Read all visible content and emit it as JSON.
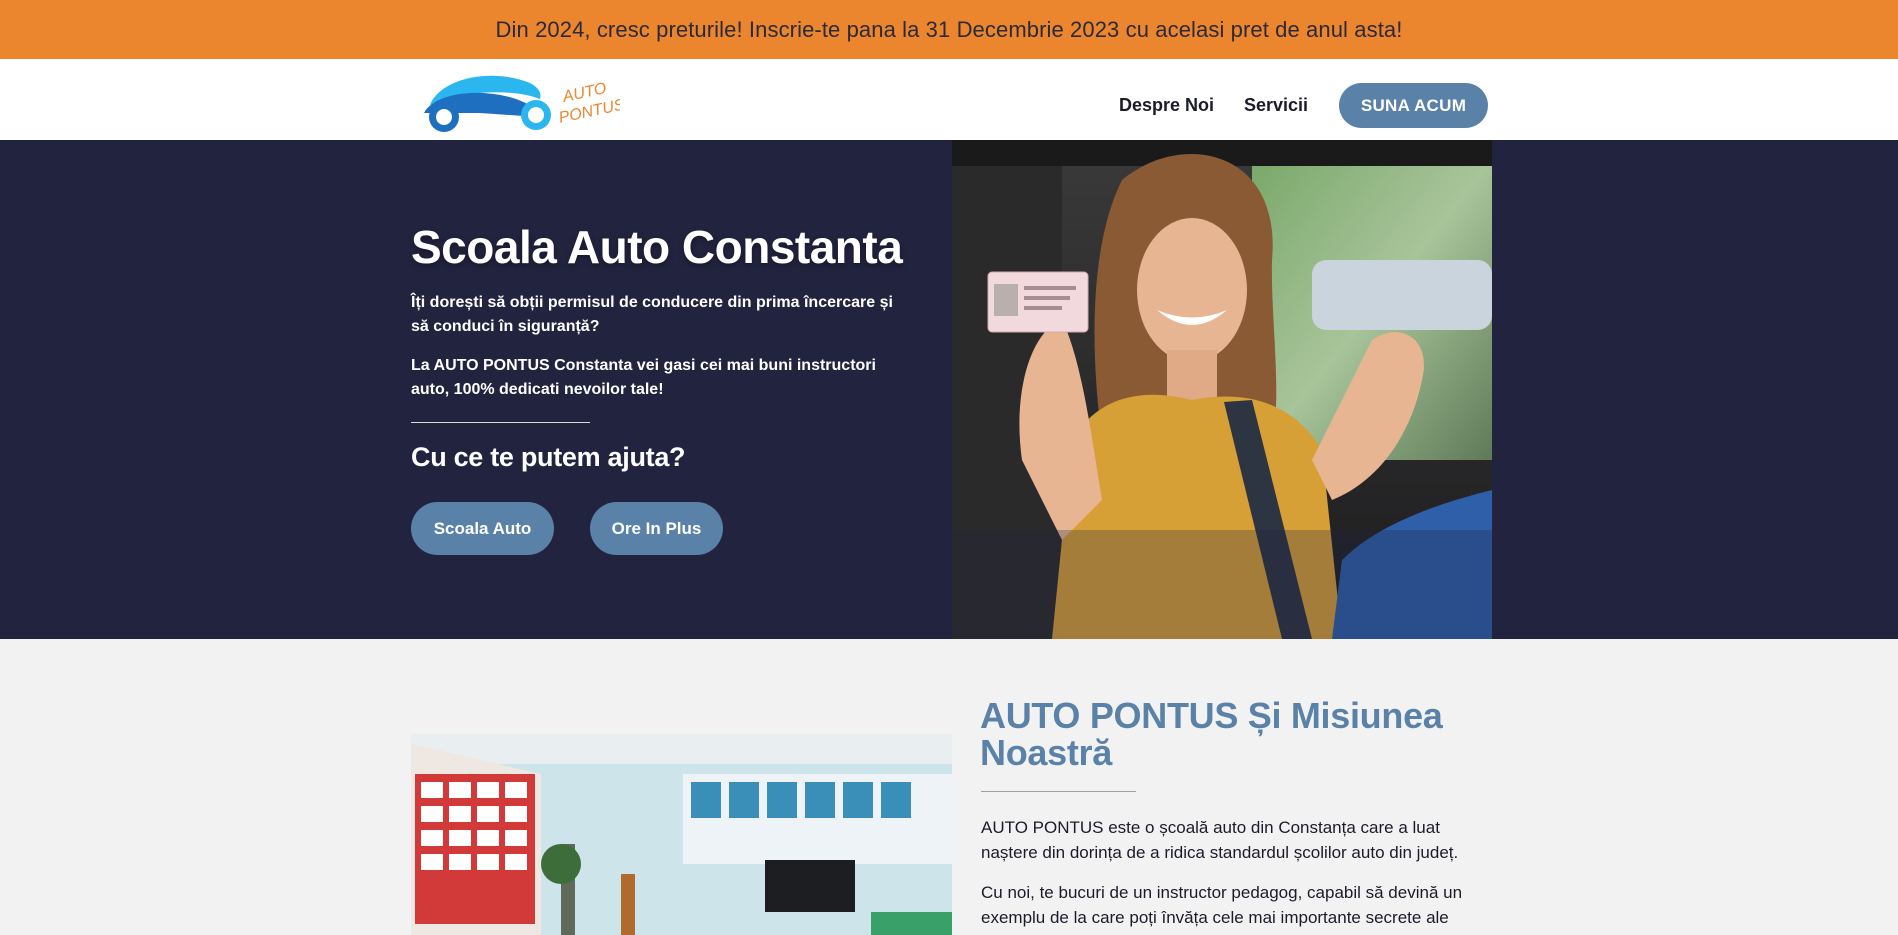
{
  "banner": {
    "text": "Din 2024, cresc preturile! Inscrie-te pana la 31 Decembrie 2023 cu acelasi pret de anul asta!"
  },
  "header": {
    "logo_text_1": "AUTO",
    "logo_text_2": "PONTUS",
    "nav": [
      "Despre Noi",
      "Servicii"
    ],
    "cta_label": "SUNA ACUM"
  },
  "hero": {
    "title": "Scoala Auto Constanta",
    "paragraph_1": "Îți dorești să obții permisul de conducere din prima încercare și să conduci în siguranță?",
    "paragraph_2": "La AUTO PONTUS Constanta vei gasi cei mai buni instructori auto, 100% dedicati nevoilor tale!",
    "subheading": "Cu ce te putem ajuta?",
    "buttons": [
      "Scoala Auto",
      "Ore In Plus"
    ]
  },
  "mission": {
    "title": "AUTO PONTUS Și Misiunea Noastră",
    "paragraph_1": "AUTO PONTUS este o școală auto din Constanța care a luat naștere din dorința de a ridica standardul școlilor auto din județ.",
    "paragraph_2": "Cu noi, te bucuri de un instructor pedagog, capabil să devină un exemplu de la care poți învăța cele mai importante secrete ale"
  },
  "colors": {
    "banner": "#ec862e",
    "hero_bg": "#22233f",
    "accent": "#5a82a8",
    "logo_blue": "#1e6fc0",
    "logo_orange": "#ec862e"
  }
}
